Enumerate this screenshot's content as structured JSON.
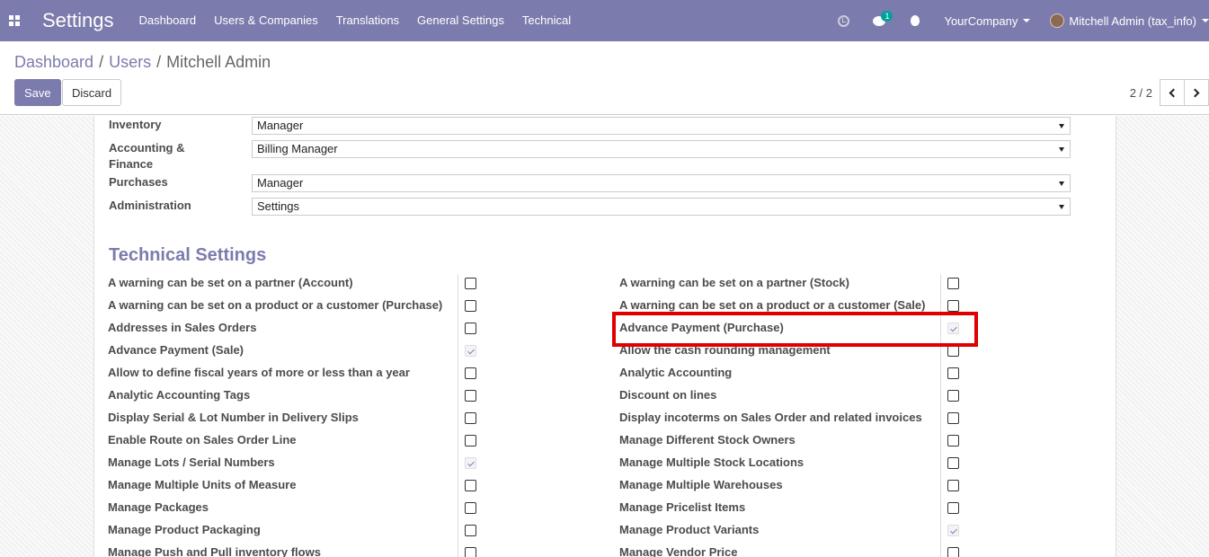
{
  "navbar": {
    "brand": "Settings",
    "menu": [
      "Dashboard",
      "Users & Companies",
      "Translations",
      "General Settings",
      "Technical"
    ],
    "chat_count": "1",
    "company": "YourCompany",
    "user": "Mitchell Admin (tax_info)",
    "bg_color": "#7c7bad"
  },
  "breadcrumb": {
    "items": [
      "Dashboard",
      "Users",
      "Mitchell Admin"
    ],
    "separator": "/"
  },
  "buttons": {
    "save": "Save",
    "discard": "Discard"
  },
  "pager": {
    "value": "2 / 2"
  },
  "access_rights": [
    {
      "label": "Inventory",
      "value": "Manager"
    },
    {
      "label": "Accounting & Finance",
      "value": "Billing Manager"
    },
    {
      "label": "Purchases",
      "value": "Manager"
    },
    {
      "label": "Administration",
      "value": "Settings"
    }
  ],
  "technical_settings": {
    "title": "Technical Settings",
    "left": [
      {
        "label": "A warning can be set on a partner (Account)",
        "checked": false
      },
      {
        "label": "A warning can be set on a product or a customer (Purchase)",
        "checked": false
      },
      {
        "label": "Addresses in Sales Orders",
        "checked": false
      },
      {
        "label": "Advance Payment (Sale)",
        "checked": true
      },
      {
        "label": "Allow to define fiscal years of more or less than a year",
        "checked": false
      },
      {
        "label": "Analytic Accounting Tags",
        "checked": false
      },
      {
        "label": "Display Serial & Lot Number in Delivery Slips",
        "checked": false
      },
      {
        "label": "Enable Route on Sales Order Line",
        "checked": false
      },
      {
        "label": "Manage Lots / Serial Numbers",
        "checked": true
      },
      {
        "label": "Manage Multiple Units of Measure",
        "checked": false
      },
      {
        "label": "Manage Packages",
        "checked": false
      },
      {
        "label": "Manage Product Packaging",
        "checked": false
      },
      {
        "label": "Manage Push and Pull inventory flows",
        "checked": false
      }
    ],
    "right": [
      {
        "label": "A warning can be set on a partner (Stock)",
        "checked": false
      },
      {
        "label": "A warning can be set on a product or a customer (Sale)",
        "checked": false
      },
      {
        "label": "Advance Payment (Purchase)",
        "checked": true
      },
      {
        "label": "Allow the cash rounding management",
        "checked": false
      },
      {
        "label": "Analytic Accounting",
        "checked": false
      },
      {
        "label": "Discount on lines",
        "checked": false
      },
      {
        "label": "Display incoterms on Sales Order and related invoices",
        "checked": false
      },
      {
        "label": "Manage Different Stock Owners",
        "checked": false
      },
      {
        "label": "Manage Multiple Stock Locations",
        "checked": false
      },
      {
        "label": "Manage Multiple Warehouses",
        "checked": false
      },
      {
        "label": "Manage Pricelist Items",
        "checked": false
      },
      {
        "label": "Manage Product Variants",
        "checked": true
      },
      {
        "label": "Manage Vendor Price",
        "checked": false
      }
    ]
  },
  "highlight_color": "#e00000"
}
